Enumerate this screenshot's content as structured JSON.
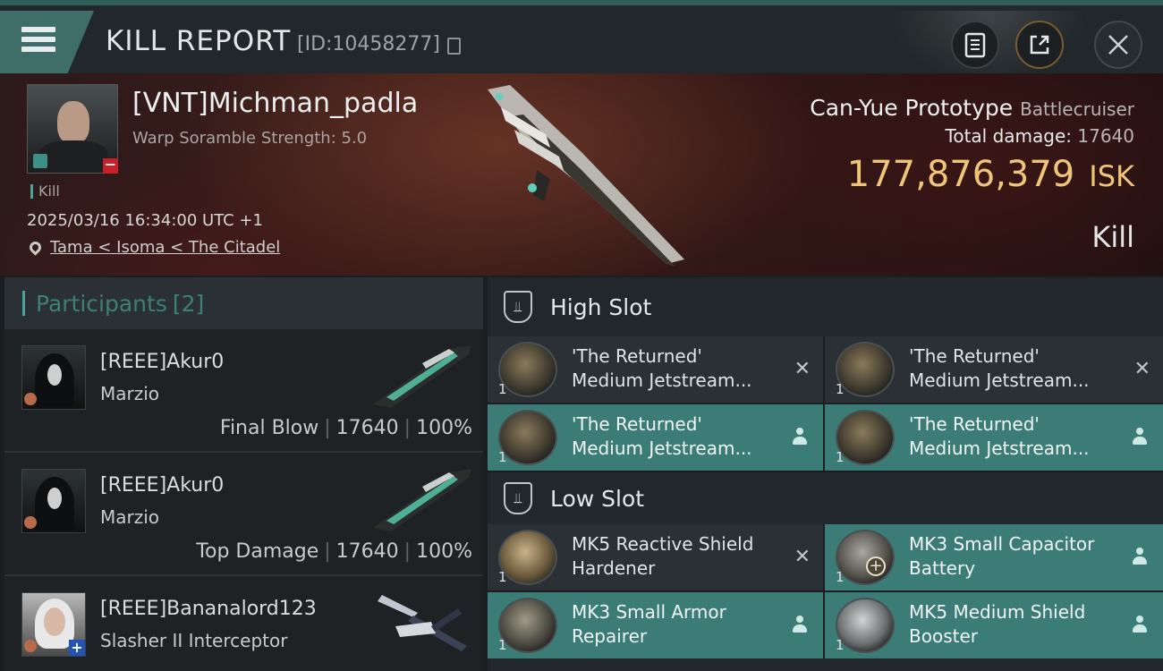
{
  "header": {
    "title": "KILL REPORT",
    "id_label": "[ID:10458277]",
    "buttons": {
      "clipboard_icon": "clipboard-icon",
      "share_icon": "share-icon",
      "close_icon": "close-icon"
    }
  },
  "victim": {
    "name": "[VNT]Michman_padla",
    "warp_scramble": "Warp Soramble Strength: 5.0",
    "kill_tag": "Kill",
    "datetime": "2025/03/16 16:34:00 UTC +1",
    "location": "Tama < Isoma < The Citadel"
  },
  "ship": {
    "name": "Can-Yue Prototype",
    "class": "Battlecruiser",
    "total_damage_label": "Total damage:",
    "total_damage_value": "17640",
    "isk_value": "177,876,379",
    "isk_unit": "ISK",
    "result": "Kill"
  },
  "participants": {
    "label": "Participants",
    "count": "[2]",
    "rows": [
      {
        "name": "[REEE]Akur0",
        "ship": "Marzio",
        "role": "Final Blow",
        "damage": "17640",
        "percent": "100%"
      },
      {
        "name": "[REEE]Akur0",
        "ship": "Marzio",
        "role": "Top Damage",
        "damage": "17640",
        "percent": "100%"
      },
      {
        "name": "[REEE]Bananalord123",
        "ship": "Slasher II Interceptor",
        "role": "",
        "damage": "",
        "percent": ""
      }
    ]
  },
  "slots": {
    "high": {
      "label": "High Slot",
      "modules": [
        {
          "line1": "'The Returned'",
          "line2": "Medium Jetstream...",
          "qty": "1",
          "state": "destroyed"
        },
        {
          "line1": "'The Returned'",
          "line2": "Medium Jetstream...",
          "qty": "1",
          "state": "destroyed"
        },
        {
          "line1": "'The Returned'",
          "line2": "Medium Jetstream...",
          "qty": "1",
          "state": "dropped"
        },
        {
          "line1": "'The Returned'",
          "line2": "Medium Jetstream...",
          "qty": "1",
          "state": "dropped"
        }
      ]
    },
    "low": {
      "label": "Low Slot",
      "modules": [
        {
          "line1": "MK5 Reactive Shield",
          "line2": "Hardener",
          "qty": "1",
          "state": "destroyed"
        },
        {
          "line1": "MK3 Small Capacitor",
          "line2": "Battery",
          "qty": "1",
          "state": "dropped"
        },
        {
          "line1": "MK3 Small Armor",
          "line2": "Repairer",
          "qty": "1",
          "state": "dropped"
        },
        {
          "line1": "MK5 Medium Shield",
          "line2": "Booster",
          "qty": "1",
          "state": "dropped"
        }
      ]
    }
  },
  "colors": {
    "accent": "#3b7d76",
    "isk": "#efc57a",
    "badge_red": "#c8202a"
  }
}
